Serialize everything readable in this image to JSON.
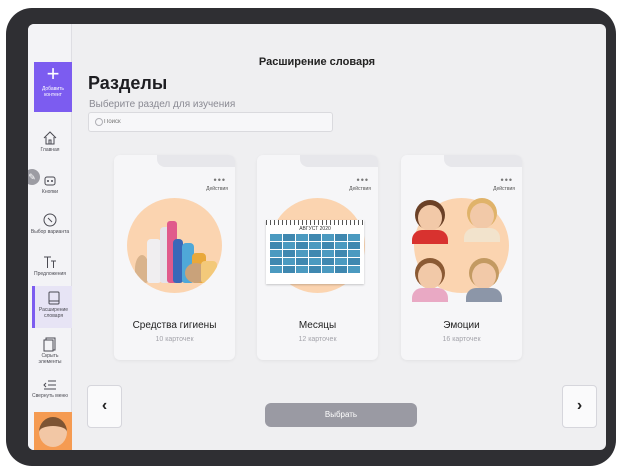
{
  "header": {
    "page_title": "Расширение словаря",
    "section_title": "Разделы",
    "subtitle": "Выберите раздел для изучения"
  },
  "search": {
    "placeholder": "Поиск",
    "value": ""
  },
  "sidebar": {
    "add_content": "Добавить контент",
    "items": [
      {
        "label": "Главная",
        "icon": "home-icon"
      },
      {
        "label": "Кнопки",
        "icon": "buttons-icon"
      },
      {
        "label": "Выбор варианта",
        "icon": "choice-icon"
      },
      {
        "label": "Предложения",
        "icon": "text-icon"
      },
      {
        "label": "Расширение словаря",
        "icon": "tablet-icon",
        "active": true
      },
      {
        "label": "Скрыть элементы",
        "icon": "hide-icon"
      },
      {
        "label": "Свернуть меню",
        "icon": "collapse-menu-icon"
      }
    ]
  },
  "cards": [
    {
      "name": "Средства гигиены",
      "count": "10 карточек",
      "more": "•••",
      "actions": "Действия",
      "image": "hygiene-products"
    },
    {
      "name": "Месяцы",
      "count": "12 карточек",
      "more": "•••",
      "actions": "Действия",
      "image": "calendar",
      "calendar_title": "АВГУСТ 2020"
    },
    {
      "name": "Эмоции",
      "count": "16 карточек",
      "more": "•••",
      "actions": "Действия",
      "image": "children-faces"
    }
  ],
  "controls": {
    "prev": "‹",
    "next": "›",
    "select_label": "Выбрать"
  },
  "colors": {
    "accent": "#7c5cf0",
    "card_circle": "#fbd4b0",
    "button_disabled": "#9a9aa3"
  }
}
